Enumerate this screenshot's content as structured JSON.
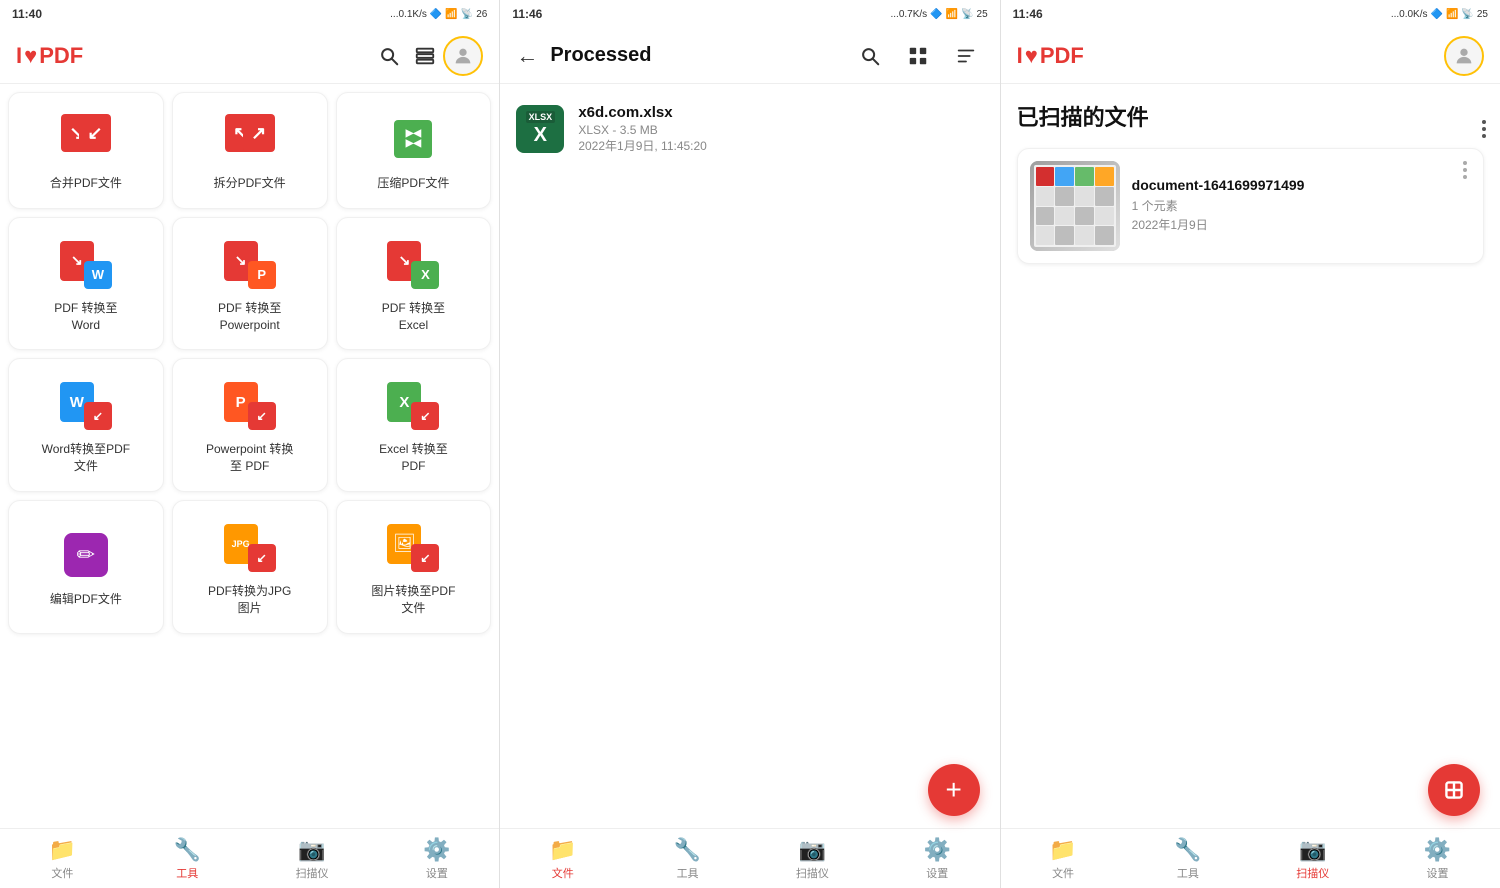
{
  "panel1": {
    "status": {
      "time": "11:40",
      "signal": "...0.1K/s",
      "battery": "26"
    },
    "logo": {
      "text": "I",
      "heart": "♥",
      "pdf": "PDF"
    },
    "nav_icons": [
      "search",
      "layers",
      "avatar"
    ],
    "tools": [
      {
        "id": "merge",
        "label": "合并PDF文件",
        "icon_color": "#e53935",
        "icon_type": "merge"
      },
      {
        "id": "split",
        "label": "拆分PDF文件",
        "icon_color": "#e53935",
        "icon_type": "split"
      },
      {
        "id": "compress",
        "label": "压缩PDF文件",
        "icon_color": "#4CAF50",
        "icon_type": "compress"
      },
      {
        "id": "pdf2word",
        "label": "PDF 转换至\nWord",
        "icon_color": "#e53935",
        "icon_type": "pdf2word"
      },
      {
        "id": "pdf2ppt",
        "label": "PDF 转换至\nPowerpoint",
        "icon_color": "#e53935",
        "icon_type": "pdf2ppt"
      },
      {
        "id": "pdf2excel",
        "label": "PDF 转换至\nExcel",
        "icon_color": "#4CAF50",
        "icon_type": "pdf2excel"
      },
      {
        "id": "word2pdf",
        "label": "Word转换至PDF\n文件",
        "icon_color": "#2196F3",
        "icon_type": "word2pdf"
      },
      {
        "id": "ppt2pdf",
        "label": "Powerpoint 转换\n至 PDF",
        "icon_color": "#FF5722",
        "icon_type": "ppt2pdf"
      },
      {
        "id": "excel2pdf",
        "label": "Excel 转换至\nPDF",
        "icon_color": "#4CAF50",
        "icon_type": "excel2pdf"
      },
      {
        "id": "editpdf",
        "label": "编辑PDF文件",
        "icon_color": "#9C27B0",
        "icon_type": "editpdf"
      },
      {
        "id": "pdf2jpg",
        "label": "PDF转换为JPG\n图片",
        "icon_color": "#FF9800",
        "icon_type": "pdf2jpg"
      },
      {
        "id": "img2pdf",
        "label": "图片转换至PDF\n文件",
        "icon_color": "#FF9800",
        "icon_type": "img2pdf"
      }
    ],
    "bottom_nav": [
      {
        "id": "files",
        "label": "文件",
        "icon": "📁",
        "active": false
      },
      {
        "id": "tools",
        "label": "工具",
        "icon": "🔧",
        "active": true
      },
      {
        "id": "scanner",
        "label": "扫描仪",
        "icon": "📷",
        "active": false
      },
      {
        "id": "settings",
        "label": "设置",
        "icon": "⚙️",
        "active": false
      }
    ]
  },
  "panel2": {
    "status": {
      "time": "11:46",
      "signal": "...0.7K/s",
      "battery": "25"
    },
    "title": "Processed",
    "nav_icons": [
      "search",
      "grid",
      "sort"
    ],
    "file": {
      "name": "x6d.com.xlsx",
      "type": "XLSX",
      "size": "3.5 MB",
      "date": "2022年1月9日, 11:45:20"
    },
    "bottom_nav": [
      {
        "id": "files",
        "label": "文件",
        "icon": "📁",
        "active": true
      },
      {
        "id": "tools",
        "label": "工具",
        "icon": "🔧",
        "active": false
      },
      {
        "id": "scanner",
        "label": "扫描仪",
        "icon": "📷",
        "active": false
      },
      {
        "id": "settings",
        "label": "设置",
        "icon": "⚙️",
        "active": false
      }
    ],
    "fab_label": "+"
  },
  "panel3": {
    "status": {
      "time": "11:46",
      "signal": "...0.0K/s",
      "battery": "25"
    },
    "logo": {
      "text": "I",
      "heart": "♥",
      "pdf": "PDF"
    },
    "nav_icons": [
      "avatar"
    ],
    "section_title": "已扫描的文件",
    "document": {
      "name": "document-1641699971499",
      "elements": "1 个元素",
      "date": "2022年1月9日"
    },
    "bottom_nav": [
      {
        "id": "files",
        "label": "文件",
        "icon": "📁",
        "active": false
      },
      {
        "id": "tools",
        "label": "工具",
        "icon": "🔧",
        "active": false
      },
      {
        "id": "scanner",
        "label": "扫描仪",
        "icon": "📷",
        "active": true
      },
      {
        "id": "settings",
        "label": "设置",
        "icon": "⚙️",
        "active": false
      }
    ],
    "fab_icon": "scan"
  }
}
